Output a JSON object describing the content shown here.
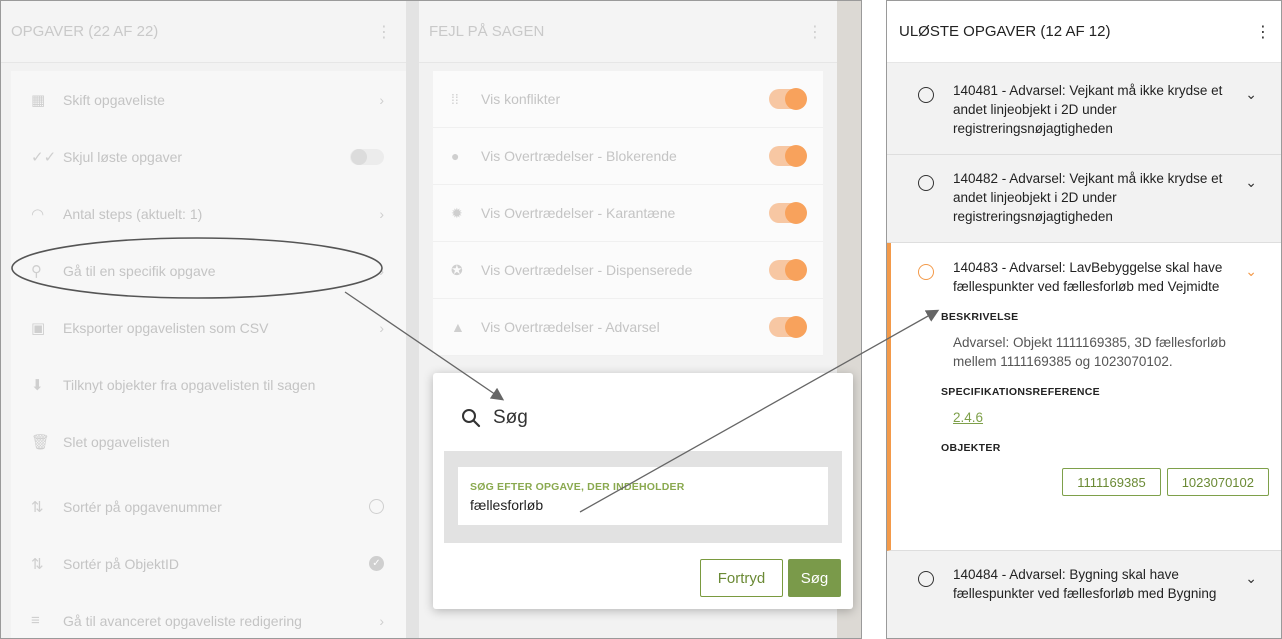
{
  "left_panel": {
    "title": "OPGAVER (22 AF 22)",
    "menu_items": [
      {
        "label": "Skift opgaveliste",
        "icon": "calendar-icon"
      },
      {
        "label": "Skjul løste opgaver",
        "icon": "double-check-icon"
      },
      {
        "label": "Antal steps (aktuelt: 1)",
        "icon": "gauge-icon"
      },
      {
        "label": "Gå til en specifik opgave",
        "icon": "search-icon"
      },
      {
        "label": "Eksporter opgavelisten som CSV",
        "icon": "clipboard-icon"
      },
      {
        "label": "Tilknyt objekter fra opgavelisten til sagen",
        "icon": "download-icon"
      },
      {
        "label": "Slet opgavelisten",
        "icon": "trash-icon"
      }
    ],
    "sort_items": [
      {
        "label": "Sortér på opgavenummer",
        "icon": "sort-icon"
      },
      {
        "label": "Sortér på ObjektID",
        "icon": "sort-icon"
      },
      {
        "label": "Gå til avanceret opgaveliste redigering",
        "icon": "edit-list-icon"
      }
    ]
  },
  "middle_panel": {
    "title": "FEJL PÅ SAGEN",
    "filters": [
      {
        "label": "Vis konflikter",
        "icon": "conflict-icon"
      },
      {
        "label": "Vis Overtrædelser - Blokerende",
        "icon": "alert-circle-icon"
      },
      {
        "label": "Vis Overtrædelser - Karantæne",
        "icon": "alert-badge-icon"
      },
      {
        "label": "Vis Overtrædelser - Dispenserede",
        "icon": "check-badge-icon"
      },
      {
        "label": "Vis Overtrædelser - Advarsel",
        "icon": "warning-triangle-icon"
      }
    ]
  },
  "dialog": {
    "title": "Søg",
    "field_label": "SØG EFTER OPGAVE, DER INDEHOLDER",
    "field_value": "fællesforløb",
    "cancel_label": "Fortryd",
    "search_label": "Søg"
  },
  "right_panel": {
    "title": "ULØSTE OPGAVER (12 AF 12)",
    "tasks": [
      {
        "text": "140481 - Advarsel: Vejkant må ikke krydse et andet linjeobjekt i 2D under registreringsnøjagtigheden"
      },
      {
        "text": "140482 - Advarsel: Vejkant må ikke krydse et andet linjeobjekt i 2D under registreringsnøjagtigheden"
      },
      {
        "text": "140483 - Advarsel: LavBebyggelse skal have fællespunkter ved fællesforløb med Vejmidte",
        "description_heading": "BESKRIVELSE",
        "description": "Advarsel: Objekt 1111169385, 3D fællesforløb mellem 1111169385 og 1023070102.",
        "spec_heading": "SPECIFIKATIONSREFERENCE",
        "spec_link": "2.4.6",
        "objects_heading": "OBJEKTER",
        "objects": [
          "1111169385",
          "1023070102"
        ]
      },
      {
        "text": "140484 - Advarsel: Bygning skal have fællespunkter ved fællesforløb med Bygning"
      }
    ]
  },
  "colors": {
    "accent_orange": "#f39a4a",
    "accent_green": "#7a9a4a"
  }
}
